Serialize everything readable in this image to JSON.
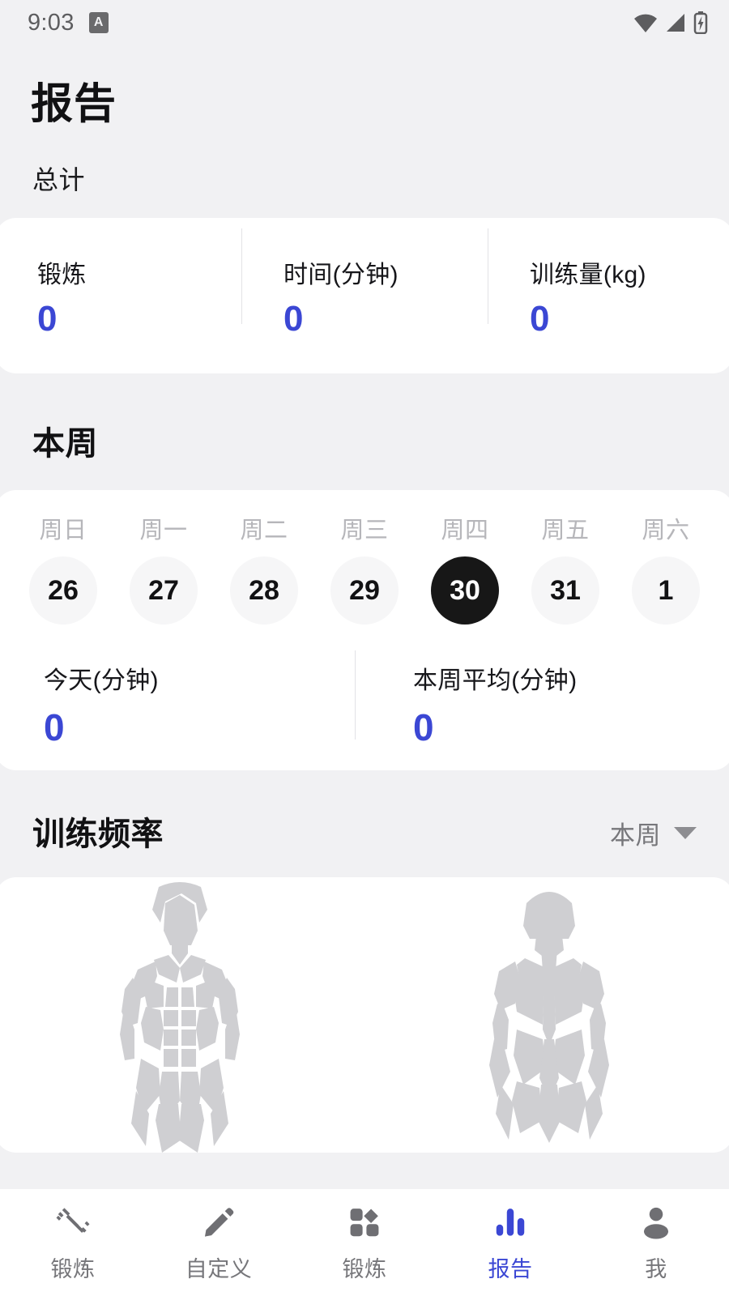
{
  "statusbar": {
    "time": "9:03",
    "app_badge": "A",
    "icons": [
      "wifi-icon",
      "signal-icon",
      "battery-charging-icon"
    ]
  },
  "header": {
    "title": "报告"
  },
  "total": {
    "section_label": "总计",
    "stats": [
      {
        "label": "锻炼",
        "value": "0"
      },
      {
        "label": "时间(分钟)",
        "value": "0"
      },
      {
        "label": "训练量(kg)",
        "value": "0"
      }
    ]
  },
  "week": {
    "section_label": "本周",
    "days": [
      {
        "name": "周日",
        "date": "26",
        "selected": false
      },
      {
        "name": "周一",
        "date": "27",
        "selected": false
      },
      {
        "name": "周二",
        "date": "28",
        "selected": false
      },
      {
        "name": "周三",
        "date": "29",
        "selected": false
      },
      {
        "name": "周四",
        "date": "30",
        "selected": true
      },
      {
        "name": "周五",
        "date": "31",
        "selected": false
      },
      {
        "name": "周六",
        "date": "1",
        "selected": false
      }
    ],
    "stats": [
      {
        "label": "今天(分钟)",
        "value": "0"
      },
      {
        "label": "本周平均(分钟)",
        "value": "0"
      }
    ]
  },
  "frequency": {
    "title": "训练频率",
    "filter_value": "本周",
    "filter_icon": "chevron-down-icon",
    "body_front_icon": "body-front-muscle-map",
    "body_back_icon": "body-back-muscle-map"
  },
  "bottomnav": [
    {
      "label": "锻炼",
      "icon": "dumbbell-icon",
      "active": false
    },
    {
      "label": "自定义",
      "icon": "pencil-icon",
      "active": false
    },
    {
      "label": "锻炼",
      "icon": "grid-icon",
      "active": false
    },
    {
      "label": "报告",
      "icon": "bar-chart-icon",
      "active": true
    },
    {
      "label": "我",
      "icon": "person-icon",
      "active": false
    }
  ],
  "colors": {
    "accent": "#3b47d4",
    "background": "#f1f1f3",
    "card": "#ffffff",
    "selected_day": "#171717",
    "muted_text": "#76767a",
    "body_silhouette": "#cfcfd2"
  }
}
